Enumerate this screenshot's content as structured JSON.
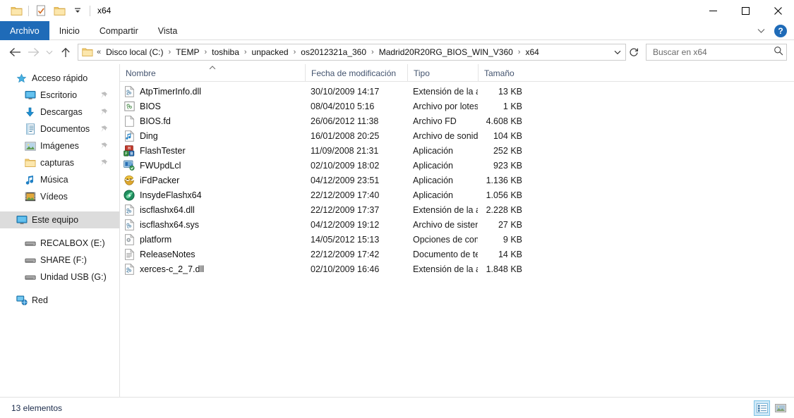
{
  "window": {
    "title": "x64",
    "quick_access_icons": [
      "folder-icon",
      "properties-icon",
      "new-folder-icon",
      "customize-qat-dropdown-icon"
    ],
    "controls": {
      "minimize": "—",
      "maximize": "☐",
      "close": "✕"
    }
  },
  "ribbon": {
    "tabs": [
      {
        "label": "Archivo",
        "active": true
      },
      {
        "label": "Inicio",
        "active": false
      },
      {
        "label": "Compartir",
        "active": false
      },
      {
        "label": "Vista",
        "active": false
      }
    ],
    "expand_label": "⌄",
    "help_label": "?"
  },
  "addressbar": {
    "back_label": "←",
    "forward_label": "→",
    "recent_label": "⌄",
    "up_label": "↑",
    "overflow_label": "«",
    "crumbs": [
      "Disco local (C:)",
      "TEMP",
      "toshiba",
      "unpacked",
      "os2012321a_360",
      "Madrid20R20RG_BIOS_WIN_V360",
      "x64"
    ],
    "separator": "›",
    "dropdown_label": "⌄",
    "refresh_label": "↻"
  },
  "search": {
    "placeholder": "Buscar en x64",
    "value": "",
    "icon": "search-icon"
  },
  "sidebar": {
    "groups": [
      {
        "name": "quick-access",
        "root": {
          "label": "Acceso rápido",
          "icon": "star-icon"
        },
        "items": [
          {
            "label": "Escritorio",
            "icon": "desktop-icon",
            "pinned": true
          },
          {
            "label": "Descargas",
            "icon": "downloads-icon",
            "pinned": true
          },
          {
            "label": "Documentos",
            "icon": "documents-icon",
            "pinned": true
          },
          {
            "label": "Imágenes",
            "icon": "pictures-icon",
            "pinned": true
          },
          {
            "label": "capturas",
            "icon": "folder-icon",
            "pinned": true
          },
          {
            "label": "Música",
            "icon": "music-icon",
            "pinned": false
          },
          {
            "label": "Vídeos",
            "icon": "videos-icon",
            "pinned": false
          }
        ]
      },
      {
        "name": "this-pc",
        "root": {
          "label": "Este equipo",
          "icon": "computer-icon",
          "selected": true
        },
        "items": []
      },
      {
        "name": "drives",
        "root": null,
        "items": [
          {
            "label": "RECALBOX (E:)",
            "icon": "drive-icon",
            "pinned": false
          },
          {
            "label": "SHARE (F:)",
            "icon": "drive-icon",
            "pinned": false
          },
          {
            "label": "Unidad USB (G:)",
            "icon": "drive-icon",
            "pinned": false
          }
        ]
      },
      {
        "name": "network",
        "root": {
          "label": "Red",
          "icon": "network-icon"
        },
        "items": []
      }
    ]
  },
  "filelist": {
    "columns": [
      {
        "key": "name",
        "label": "Nombre",
        "sorted": "asc"
      },
      {
        "key": "date",
        "label": "Fecha de modificación",
        "sorted": null
      },
      {
        "key": "type",
        "label": "Tipo",
        "sorted": null
      },
      {
        "key": "size",
        "label": "Tamaño",
        "sorted": null
      }
    ],
    "rows": [
      {
        "icon": "dll-file-icon",
        "name": "AtpTimerInfo.dll",
        "date": "30/10/2009 14:17",
        "type": "Extensión de la ap...",
        "size": "13 KB"
      },
      {
        "icon": "bat-file-icon",
        "name": "BIOS",
        "date": "08/04/2010 5:16",
        "type": "Archivo por lotes ...",
        "size": "1 KB"
      },
      {
        "icon": "blank-file-icon",
        "name": "BIOS.fd",
        "date": "26/06/2012 11:38",
        "type": "Archivo FD",
        "size": "4.608 KB"
      },
      {
        "icon": "sound-file-icon",
        "name": "Ding",
        "date": "16/01/2008 20:25",
        "type": "Archivo de sonido",
        "size": "104 KB"
      },
      {
        "icon": "flashtester-app-icon",
        "name": "FlashTester",
        "date": "11/09/2008 21:31",
        "type": "Aplicación",
        "size": "252 KB"
      },
      {
        "icon": "fwupdlcl-app-icon",
        "name": "FWUpdLcl",
        "date": "02/10/2009 18:02",
        "type": "Aplicación",
        "size": "923 KB"
      },
      {
        "icon": "ifdpacker-app-icon",
        "name": "iFdPacker",
        "date": "04/12/2009 23:51",
        "type": "Aplicación",
        "size": "1.136 KB"
      },
      {
        "icon": "insydeflash-app-icon",
        "name": "InsydeFlashx64",
        "date": "22/12/2009 17:40",
        "type": "Aplicación",
        "size": "1.056 KB"
      },
      {
        "icon": "dll-file-icon",
        "name": "iscflashx64.dll",
        "date": "22/12/2009 17:37",
        "type": "Extensión de la ap...",
        "size": "2.228 KB"
      },
      {
        "icon": "sys-file-icon",
        "name": "iscflashx64.sys",
        "date": "04/12/2009 19:12",
        "type": "Archivo de sistema",
        "size": "27 KB"
      },
      {
        "icon": "config-file-icon",
        "name": "platform",
        "date": "14/05/2012 15:13",
        "type": "Opciones de confi...",
        "size": "9 KB"
      },
      {
        "icon": "text-file-icon",
        "name": "ReleaseNotes",
        "date": "22/12/2009 17:42",
        "type": "Documento de te...",
        "size": "14 KB"
      },
      {
        "icon": "dll-file-icon",
        "name": "xerces-c_2_7.dll",
        "date": "02/10/2009 16:46",
        "type": "Extensión de la ap...",
        "size": "1.848 KB"
      }
    ]
  },
  "statusbar": {
    "item_count_text": "13 elementos",
    "views": [
      {
        "name": "details-view",
        "active": true
      },
      {
        "name": "large-icons-view",
        "active": false
      }
    ]
  },
  "colors": {
    "accent": "#1f6bb8",
    "selection": "#dcdcdc",
    "hover": "#e5f3fb",
    "header_text": "#44546f",
    "close_hover": "#e81123"
  }
}
